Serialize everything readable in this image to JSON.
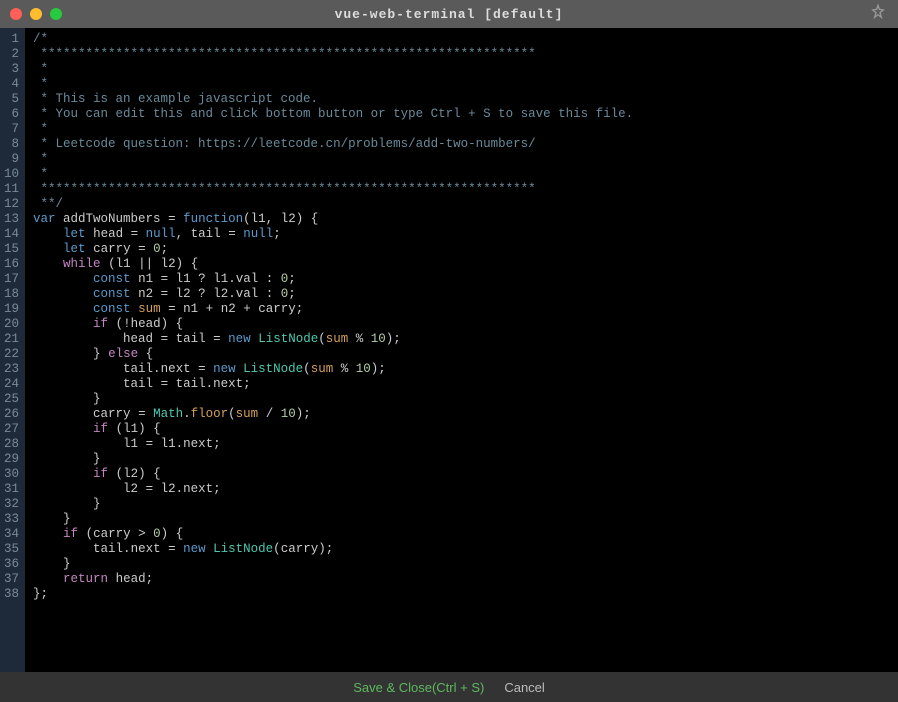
{
  "titlebar": {
    "title": "vue-web-terminal [default]"
  },
  "footer": {
    "save": "Save & Close(Ctrl + S)",
    "cancel": "Cancel"
  },
  "code": {
    "lines": [
      {
        "n": 1,
        "t": "comment",
        "s": "/*"
      },
      {
        "n": 2,
        "t": "comment",
        "s": " ******************************************************************"
      },
      {
        "n": 3,
        "t": "comment",
        "s": " *"
      },
      {
        "n": 4,
        "t": "comment",
        "s": " *"
      },
      {
        "n": 5,
        "t": "comment",
        "s": " * This is an example javascript code."
      },
      {
        "n": 6,
        "t": "comment",
        "s": " * You can edit this and click bottom button or type Ctrl + S to save this file."
      },
      {
        "n": 7,
        "t": "comment",
        "s": " *"
      },
      {
        "n": 8,
        "t": "comment",
        "s": " * Leetcode question: https://leetcode.cn/problems/add-two-numbers/"
      },
      {
        "n": 9,
        "t": "comment",
        "s": " *"
      },
      {
        "n": 10,
        "t": "comment",
        "s": " *"
      },
      {
        "n": 11,
        "t": "comment",
        "s": " ******************************************************************"
      },
      {
        "n": 12,
        "t": "comment",
        "s": " **/"
      },
      {
        "n": 13,
        "t": "code",
        "tokens": [
          [
            "kw",
            "var"
          ],
          [
            "sp",
            " "
          ],
          [
            "ident",
            "addTwoNumbers"
          ],
          [
            "sp",
            " "
          ],
          [
            "op",
            "="
          ],
          [
            "sp",
            " "
          ],
          [
            "kw",
            "function"
          ],
          [
            "op",
            "("
          ],
          [
            "ident",
            "l1"
          ],
          [
            "op",
            ","
          ],
          [
            "sp",
            " "
          ],
          [
            "ident",
            "l2"
          ],
          [
            "op",
            ")"
          ],
          [
            "sp",
            " "
          ],
          [
            "op",
            "{"
          ]
        ]
      },
      {
        "n": 14,
        "t": "code",
        "tokens": [
          [
            "sp",
            "    "
          ],
          [
            "kw",
            "let"
          ],
          [
            "sp",
            " "
          ],
          [
            "ident",
            "head"
          ],
          [
            "sp",
            " "
          ],
          [
            "op",
            "="
          ],
          [
            "sp",
            " "
          ],
          [
            "null",
            "null"
          ],
          [
            "op",
            ","
          ],
          [
            "sp",
            " "
          ],
          [
            "ident",
            "tail"
          ],
          [
            "sp",
            " "
          ],
          [
            "op",
            "="
          ],
          [
            "sp",
            " "
          ],
          [
            "null",
            "null"
          ],
          [
            "op",
            ";"
          ]
        ]
      },
      {
        "n": 15,
        "t": "code",
        "tokens": [
          [
            "sp",
            "    "
          ],
          [
            "kw",
            "let"
          ],
          [
            "sp",
            " "
          ],
          [
            "ident",
            "carry"
          ],
          [
            "sp",
            " "
          ],
          [
            "op",
            "="
          ],
          [
            "sp",
            " "
          ],
          [
            "num",
            "0"
          ],
          [
            "op",
            ";"
          ]
        ]
      },
      {
        "n": 16,
        "t": "code",
        "tokens": [
          [
            "sp",
            "    "
          ],
          [
            "kw2",
            "while"
          ],
          [
            "sp",
            " "
          ],
          [
            "op",
            "("
          ],
          [
            "ident",
            "l1"
          ],
          [
            "sp",
            " "
          ],
          [
            "op",
            "||"
          ],
          [
            "sp",
            " "
          ],
          [
            "ident",
            "l2"
          ],
          [
            "op",
            ")"
          ],
          [
            "sp",
            " "
          ],
          [
            "op",
            "{"
          ]
        ]
      },
      {
        "n": 17,
        "t": "code",
        "tokens": [
          [
            "sp",
            "        "
          ],
          [
            "kw",
            "const"
          ],
          [
            "sp",
            " "
          ],
          [
            "ident",
            "n1"
          ],
          [
            "sp",
            " "
          ],
          [
            "op",
            "="
          ],
          [
            "sp",
            " "
          ],
          [
            "ident",
            "l1"
          ],
          [
            "sp",
            " "
          ],
          [
            "op",
            "?"
          ],
          [
            "sp",
            " "
          ],
          [
            "ident",
            "l1"
          ],
          [
            "op",
            "."
          ],
          [
            "prop",
            "val"
          ],
          [
            "sp",
            " "
          ],
          [
            "op",
            ":"
          ],
          [
            "sp",
            " "
          ],
          [
            "num",
            "0"
          ],
          [
            "op",
            ";"
          ]
        ]
      },
      {
        "n": 18,
        "t": "code",
        "tokens": [
          [
            "sp",
            "        "
          ],
          [
            "kw",
            "const"
          ],
          [
            "sp",
            " "
          ],
          [
            "ident",
            "n2"
          ],
          [
            "sp",
            " "
          ],
          [
            "op",
            "="
          ],
          [
            "sp",
            " "
          ],
          [
            "ident",
            "l2"
          ],
          [
            "sp",
            " "
          ],
          [
            "op",
            "?"
          ],
          [
            "sp",
            " "
          ],
          [
            "ident",
            "l2"
          ],
          [
            "op",
            "."
          ],
          [
            "prop",
            "val"
          ],
          [
            "sp",
            " "
          ],
          [
            "op",
            ":"
          ],
          [
            "sp",
            " "
          ],
          [
            "num",
            "0"
          ],
          [
            "op",
            ";"
          ]
        ]
      },
      {
        "n": 19,
        "t": "code",
        "tokens": [
          [
            "sp",
            "        "
          ],
          [
            "kw",
            "const"
          ],
          [
            "sp",
            " "
          ],
          [
            "fn",
            "sum"
          ],
          [
            "sp",
            " "
          ],
          [
            "op",
            "="
          ],
          [
            "sp",
            " "
          ],
          [
            "ident",
            "n1"
          ],
          [
            "sp",
            " "
          ],
          [
            "op",
            "+"
          ],
          [
            "sp",
            " "
          ],
          [
            "ident",
            "n2"
          ],
          [
            "sp",
            " "
          ],
          [
            "op",
            "+"
          ],
          [
            "sp",
            " "
          ],
          [
            "ident",
            "carry"
          ],
          [
            "op",
            ";"
          ]
        ]
      },
      {
        "n": 20,
        "t": "code",
        "tokens": [
          [
            "sp",
            "        "
          ],
          [
            "kw2",
            "if"
          ],
          [
            "sp",
            " "
          ],
          [
            "op",
            "(!"
          ],
          [
            "ident",
            "head"
          ],
          [
            "op",
            ")"
          ],
          [
            "sp",
            " "
          ],
          [
            "op",
            "{"
          ]
        ]
      },
      {
        "n": 21,
        "t": "code",
        "tokens": [
          [
            "sp",
            "            "
          ],
          [
            "ident",
            "head"
          ],
          [
            "sp",
            " "
          ],
          [
            "op",
            "="
          ],
          [
            "sp",
            " "
          ],
          [
            "ident",
            "tail"
          ],
          [
            "sp",
            " "
          ],
          [
            "op",
            "="
          ],
          [
            "sp",
            " "
          ],
          [
            "new",
            "new"
          ],
          [
            "sp",
            " "
          ],
          [
            "type",
            "ListNode"
          ],
          [
            "op",
            "("
          ],
          [
            "fn",
            "sum"
          ],
          [
            "sp",
            " "
          ],
          [
            "op",
            "%"
          ],
          [
            "sp",
            " "
          ],
          [
            "num",
            "10"
          ],
          [
            "op",
            ");"
          ]
        ]
      },
      {
        "n": 22,
        "t": "code",
        "tokens": [
          [
            "sp",
            "        "
          ],
          [
            "op",
            "}"
          ],
          [
            "sp",
            " "
          ],
          [
            "kw2",
            "else"
          ],
          [
            "sp",
            " "
          ],
          [
            "op",
            "{"
          ]
        ]
      },
      {
        "n": 23,
        "t": "code",
        "tokens": [
          [
            "sp",
            "            "
          ],
          [
            "ident",
            "tail"
          ],
          [
            "op",
            "."
          ],
          [
            "prop",
            "next"
          ],
          [
            "sp",
            " "
          ],
          [
            "op",
            "="
          ],
          [
            "sp",
            " "
          ],
          [
            "new",
            "new"
          ],
          [
            "sp",
            " "
          ],
          [
            "type",
            "ListNode"
          ],
          [
            "op",
            "("
          ],
          [
            "fn",
            "sum"
          ],
          [
            "sp",
            " "
          ],
          [
            "op",
            "%"
          ],
          [
            "sp",
            " "
          ],
          [
            "num",
            "10"
          ],
          [
            "op",
            ");"
          ]
        ]
      },
      {
        "n": 24,
        "t": "code",
        "tokens": [
          [
            "sp",
            "            "
          ],
          [
            "ident",
            "tail"
          ],
          [
            "sp",
            " "
          ],
          [
            "op",
            "="
          ],
          [
            "sp",
            " "
          ],
          [
            "ident",
            "tail"
          ],
          [
            "op",
            "."
          ],
          [
            "prop",
            "next"
          ],
          [
            "op",
            ";"
          ]
        ]
      },
      {
        "n": 25,
        "t": "code",
        "tokens": [
          [
            "sp",
            "        "
          ],
          [
            "op",
            "}"
          ]
        ]
      },
      {
        "n": 26,
        "t": "code",
        "tokens": [
          [
            "sp",
            "        "
          ],
          [
            "ident",
            "carry"
          ],
          [
            "sp",
            " "
          ],
          [
            "op",
            "="
          ],
          [
            "sp",
            " "
          ],
          [
            "type",
            "Math"
          ],
          [
            "op",
            "."
          ],
          [
            "fn",
            "floor"
          ],
          [
            "op",
            "("
          ],
          [
            "fn",
            "sum"
          ],
          [
            "sp",
            " "
          ],
          [
            "op",
            "/"
          ],
          [
            "sp",
            " "
          ],
          [
            "num",
            "10"
          ],
          [
            "op",
            ");"
          ]
        ]
      },
      {
        "n": 27,
        "t": "code",
        "tokens": [
          [
            "sp",
            "        "
          ],
          [
            "kw2",
            "if"
          ],
          [
            "sp",
            " "
          ],
          [
            "op",
            "("
          ],
          [
            "ident",
            "l1"
          ],
          [
            "op",
            ")"
          ],
          [
            "sp",
            " "
          ],
          [
            "op",
            "{"
          ]
        ]
      },
      {
        "n": 28,
        "t": "code",
        "tokens": [
          [
            "sp",
            "            "
          ],
          [
            "ident",
            "l1"
          ],
          [
            "sp",
            " "
          ],
          [
            "op",
            "="
          ],
          [
            "sp",
            " "
          ],
          [
            "ident",
            "l1"
          ],
          [
            "op",
            "."
          ],
          [
            "prop",
            "next"
          ],
          [
            "op",
            ";"
          ]
        ]
      },
      {
        "n": 29,
        "t": "code",
        "tokens": [
          [
            "sp",
            "        "
          ],
          [
            "op",
            "}"
          ]
        ]
      },
      {
        "n": 30,
        "t": "code",
        "tokens": [
          [
            "sp",
            "        "
          ],
          [
            "kw2",
            "if"
          ],
          [
            "sp",
            " "
          ],
          [
            "op",
            "("
          ],
          [
            "ident",
            "l2"
          ],
          [
            "op",
            ")"
          ],
          [
            "sp",
            " "
          ],
          [
            "op",
            "{"
          ]
        ]
      },
      {
        "n": 31,
        "t": "code",
        "tokens": [
          [
            "sp",
            "            "
          ],
          [
            "ident",
            "l2"
          ],
          [
            "sp",
            " "
          ],
          [
            "op",
            "="
          ],
          [
            "sp",
            " "
          ],
          [
            "ident",
            "l2"
          ],
          [
            "op",
            "."
          ],
          [
            "prop",
            "next"
          ],
          [
            "op",
            ";"
          ]
        ]
      },
      {
        "n": 32,
        "t": "code",
        "tokens": [
          [
            "sp",
            "        "
          ],
          [
            "op",
            "}"
          ]
        ]
      },
      {
        "n": 33,
        "t": "code",
        "tokens": [
          [
            "sp",
            "    "
          ],
          [
            "op",
            "}"
          ]
        ]
      },
      {
        "n": 34,
        "t": "code",
        "tokens": [
          [
            "sp",
            "    "
          ],
          [
            "kw2",
            "if"
          ],
          [
            "sp",
            " "
          ],
          [
            "op",
            "("
          ],
          [
            "ident",
            "carry"
          ],
          [
            "sp",
            " "
          ],
          [
            "op",
            ">"
          ],
          [
            "sp",
            " "
          ],
          [
            "num",
            "0"
          ],
          [
            "op",
            ")"
          ],
          [
            "sp",
            " "
          ],
          [
            "op",
            "{"
          ]
        ]
      },
      {
        "n": 35,
        "t": "code",
        "tokens": [
          [
            "sp",
            "        "
          ],
          [
            "ident",
            "tail"
          ],
          [
            "op",
            "."
          ],
          [
            "prop",
            "next"
          ],
          [
            "sp",
            " "
          ],
          [
            "op",
            "="
          ],
          [
            "sp",
            " "
          ],
          [
            "new",
            "new"
          ],
          [
            "sp",
            " "
          ],
          [
            "type",
            "ListNode"
          ],
          [
            "op",
            "("
          ],
          [
            "ident",
            "carry"
          ],
          [
            "op",
            ");"
          ]
        ]
      },
      {
        "n": 36,
        "t": "code",
        "tokens": [
          [
            "sp",
            "    "
          ],
          [
            "op",
            "}"
          ]
        ]
      },
      {
        "n": 37,
        "t": "code",
        "tokens": [
          [
            "sp",
            "    "
          ],
          [
            "kw2",
            "return"
          ],
          [
            "sp",
            " "
          ],
          [
            "ident",
            "head"
          ],
          [
            "op",
            ";"
          ]
        ]
      },
      {
        "n": 38,
        "t": "code",
        "tokens": [
          [
            "op",
            "};"
          ]
        ]
      }
    ]
  }
}
